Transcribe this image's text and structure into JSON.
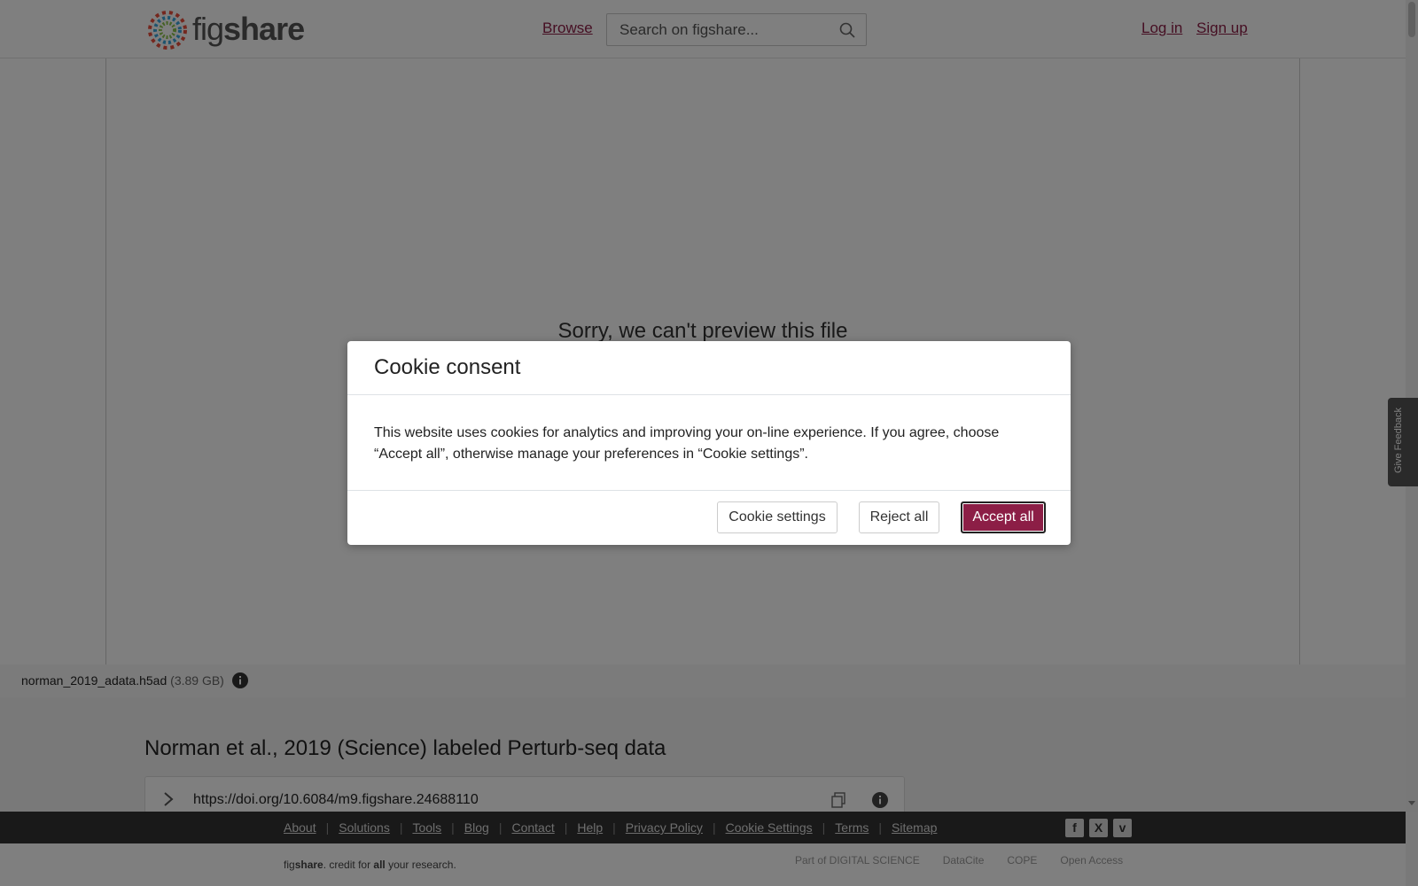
{
  "header": {
    "logo_prefix": "fig",
    "logo_suffix": "share",
    "browse_label": "Browse",
    "search_placeholder": "Search on figshare...",
    "login_label": "Log in",
    "signup_label": "Sign up"
  },
  "preview": {
    "message": "Sorry, we can't preview this file"
  },
  "file": {
    "name": "norman_2019_adata.h5ad",
    "size": "(3.89 GB)"
  },
  "item": {
    "title": "Norman et al., 2019 (Science) labeled Perturb-seq data",
    "doi": "https://doi.org/10.6084/m9.figshare.24688110"
  },
  "footer": {
    "links": [
      "About",
      "Solutions",
      "Tools",
      "Blog",
      "Contact",
      "Help",
      "Privacy Policy",
      "Cookie Settings",
      "Terms",
      "Sitemap"
    ],
    "separator": "|",
    "social": [
      "f",
      "X",
      "v"
    ],
    "tagline_pre": "fig",
    "tagline_share": "share",
    "tagline_mid": ". credit for ",
    "tagline_all": "all",
    "tagline_post": " your research.",
    "partners": [
      "Part of DIGITAL SCIENCE",
      "DataCite",
      "COPE",
      "Open Access"
    ]
  },
  "feedback_label": "Give Feedback",
  "cookie_modal": {
    "title": "Cookie consent",
    "body": "This website uses cookies for analytics and improving your on-line experience. If you agree, choose “Accept all”, otherwise manage your preferences in “Cookie settings”.",
    "settings_label": "Cookie settings",
    "reject_label": "Reject all",
    "accept_label": "Accept all"
  },
  "colors": {
    "brand": "#8c1e46",
    "overlay": "rgba(0,0,0,0.5)"
  }
}
